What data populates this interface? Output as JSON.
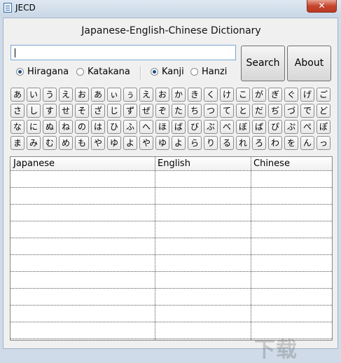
{
  "window": {
    "title": "JECD",
    "close_glyph": "✕"
  },
  "header": {
    "heading": "Japanese-English-Chinese Dictionary"
  },
  "search": {
    "value": "",
    "search_label": "Search",
    "about_label": "About"
  },
  "script_options": {
    "hiragana": "Hiragana",
    "katakana": "Katakana",
    "selected": "Hiragana"
  },
  "output_options": {
    "kanji": "Kanji",
    "hanzi": "Hanzi",
    "selected": "Kanji"
  },
  "kana_rows": [
    [
      "あ",
      "い",
      "う",
      "え",
      "お",
      "あ",
      "ぃ",
      "ぅ",
      "え",
      "お",
      "か",
      "き",
      "く",
      "け",
      "こ",
      "が",
      "ぎ",
      "ぐ",
      "げ",
      "ご"
    ],
    [
      "さ",
      "し",
      "す",
      "せ",
      "そ",
      "ざ",
      "じ",
      "ず",
      "ぜ",
      "ぞ",
      "た",
      "ち",
      "つ",
      "て",
      "と",
      "だ",
      "ぢ",
      "づ",
      "で",
      "ど"
    ],
    [
      "な",
      "に",
      "ぬ",
      "ね",
      "の",
      "は",
      "ひ",
      "ふ",
      "へ",
      "ほ",
      "ば",
      "び",
      "ぶ",
      "べ",
      "ぼ",
      "ぱ",
      "ぴ",
      "ぷ",
      "ぺ",
      "ぽ"
    ],
    [
      "ま",
      "み",
      "む",
      "め",
      "も",
      "や",
      "ゆ",
      "よ",
      "や",
      "ゆ",
      "よ",
      "ら",
      "り",
      "る",
      "れ",
      "ろ",
      "わ",
      "を",
      "ん",
      "っ"
    ]
  ],
  "results_table": {
    "columns": [
      "Japanese",
      "English",
      "Chinese"
    ],
    "rows": []
  },
  "watermark": "下载"
}
